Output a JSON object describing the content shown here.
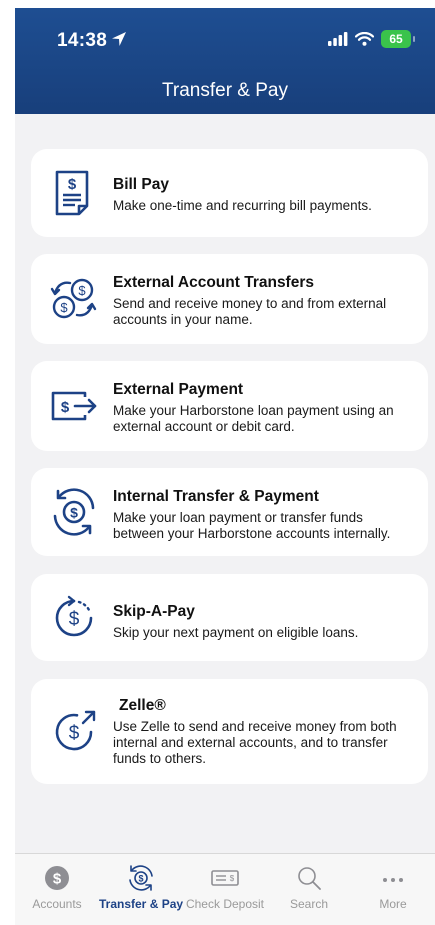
{
  "status_bar": {
    "time": "14:38",
    "battery": "65"
  },
  "header": {
    "title": "Transfer & Pay"
  },
  "menu": [
    {
      "title": "Bill Pay",
      "description": "Make one-time and recurring bill payments.",
      "icon": "bill-icon"
    },
    {
      "title": "External Account Transfers",
      "description": "Send and receive money to and from external accounts in your name.",
      "icon": "exchange-coins-icon"
    },
    {
      "title": "External Payment",
      "description": "Make your Harborstone loan payment using an external account or debit card.",
      "icon": "external-payment-icon"
    },
    {
      "title": "Internal Transfer & Payment",
      "description": "Make your loan payment or transfer funds between your Harborstone accounts internally.",
      "icon": "internal-transfer-icon"
    },
    {
      "title": "Skip-A-Pay",
      "description": "Skip your next payment on eligible loans.",
      "icon": "skip-pay-icon"
    },
    {
      "title": "Zelle®",
      "description": "Use Zelle to send and receive money from both internal and external accounts, and to transfer funds to others.",
      "icon": "zelle-icon"
    }
  ],
  "tabs": [
    {
      "label": "Accounts",
      "icon": "dollar-circle-icon",
      "active": false
    },
    {
      "label": "Transfer & Pay",
      "icon": "transfer-icon",
      "active": true
    },
    {
      "label": "Check Deposit",
      "icon": "check-icon",
      "active": false
    },
    {
      "label": "Search",
      "icon": "search-icon",
      "active": false
    },
    {
      "label": "More",
      "icon": "more-icon",
      "active": false
    }
  ],
  "colors": {
    "brand": "#1d4286",
    "header": "#1e4e92",
    "battery": "#3ac34b"
  }
}
